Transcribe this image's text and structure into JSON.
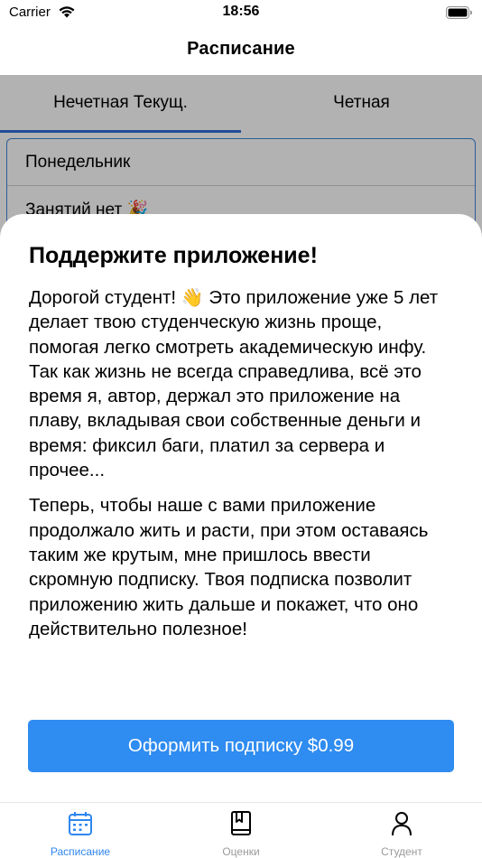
{
  "status_bar": {
    "carrier": "Carrier",
    "time": "18:56"
  },
  "nav": {
    "title": "Расписание"
  },
  "schedule": {
    "tabs": [
      {
        "label": "Нечетная Текущ.",
        "active": true
      },
      {
        "label": "Четная",
        "active": false
      }
    ],
    "days": [
      {
        "label": "Понедельник"
      },
      {
        "label": "Занятий нет 🎉"
      }
    ]
  },
  "sheet": {
    "title": "Поддержите приложение!",
    "paragraph1_before_emoji": "Дорогой студент!",
    "paragraph1_emoji": "👋",
    "paragraph1_after_emoji": " Это приложение уже 5 лет делает твою студенческую жизнь проще, помогая легко смотреть академическую инфу. Так как жизнь не всегда справедлива, всё это время я, автор, держал это приложение на плаву, вкладывая свои собственные деньги и время: фиксил баги, платил за сервера и прочее...",
    "paragraph2": "Теперь, чтобы наше с вами приложение продолжало жить и расти, при этом оставаясь таким же крутым, мне пришлось ввести скромную подписку. Твоя подписка позволит приложению жить дальше и покажет, что оно действительно полезное!",
    "subscribe_label": "Оформить подписку $0.99"
  },
  "tab_bar": {
    "items": [
      {
        "label": "Расписание",
        "icon": "calendar-icon",
        "active": true
      },
      {
        "label": "Оценки",
        "icon": "book-icon",
        "active": false
      },
      {
        "label": "Студент",
        "icon": "person-icon",
        "active": false
      }
    ]
  },
  "colors": {
    "accent": "#2f86ee",
    "button": "#2f8cf0",
    "tab_underline": "#2f6fd8"
  }
}
